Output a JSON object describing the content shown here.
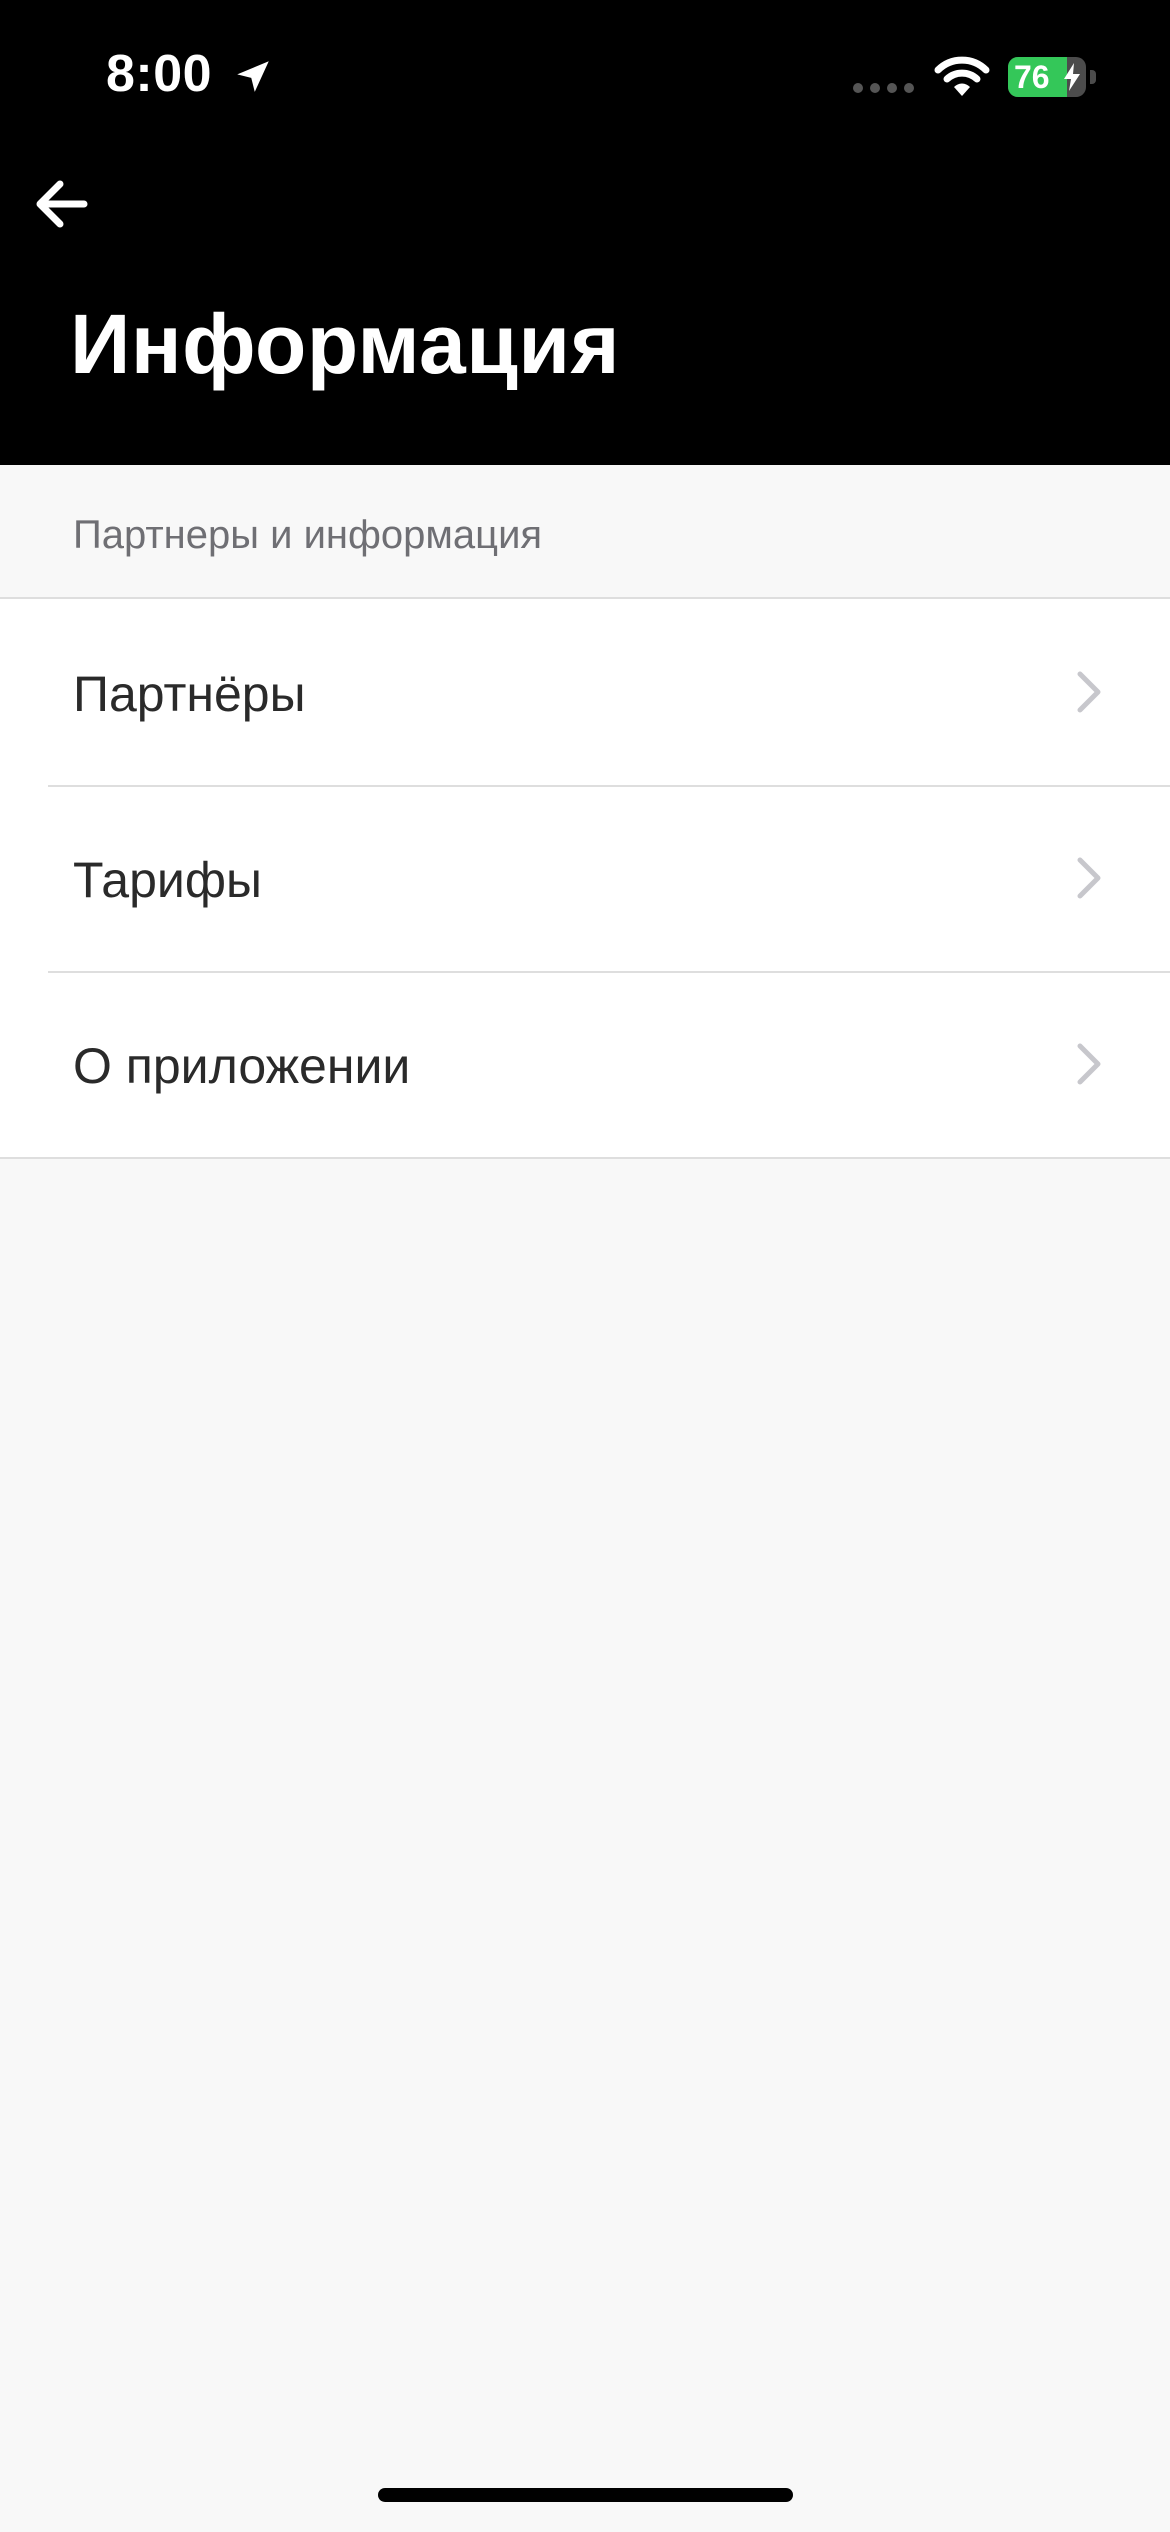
{
  "status_bar": {
    "time": "8:00",
    "battery_level": "76",
    "battery_fraction": 0.76,
    "icons": [
      "location-arrow-icon",
      "cellular-signal-icon",
      "wifi-icon",
      "battery-charging-icon"
    ]
  },
  "header": {
    "back_icon": "arrow-left-icon",
    "title": "Информация"
  },
  "section": {
    "label": "Партнеры и информация"
  },
  "items": [
    {
      "label": "Партнёры"
    },
    {
      "label": "Тарифы"
    },
    {
      "label": "О приложении"
    }
  ],
  "colors": {
    "header_bg": "#000000",
    "page_bg": "#f8f8f8",
    "battery_green": "#34c759"
  }
}
